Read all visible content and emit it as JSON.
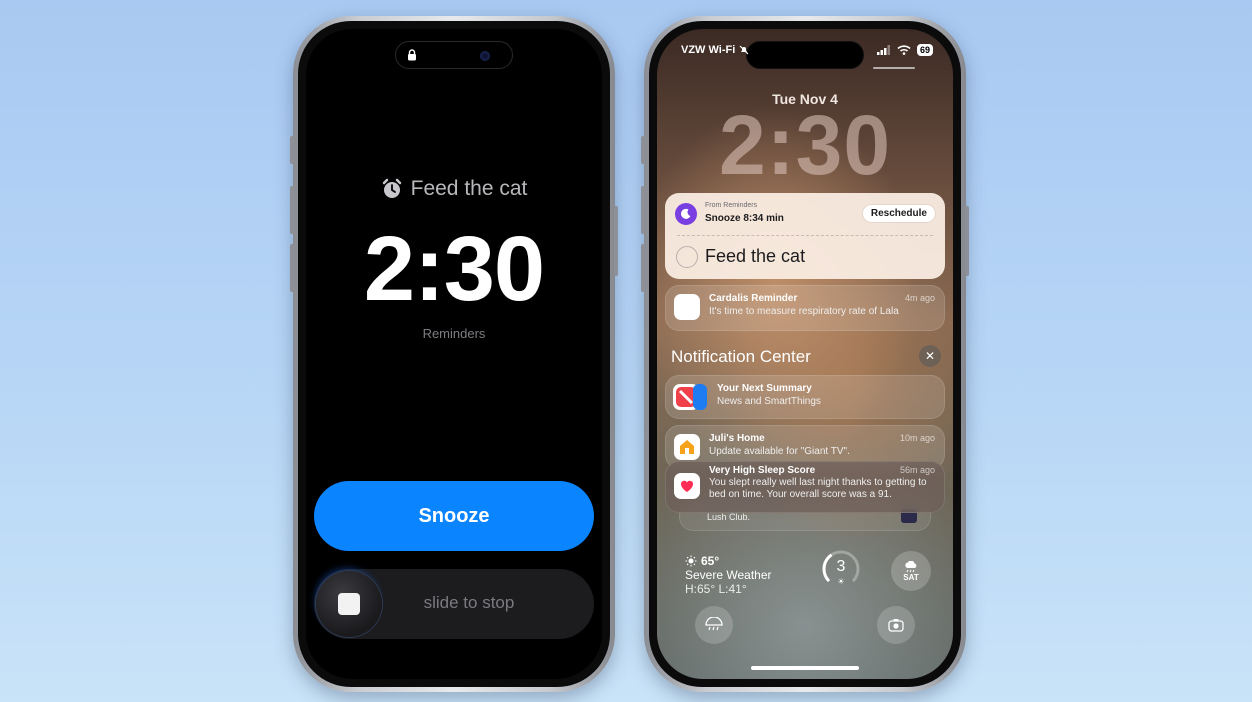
{
  "left_phone": {
    "alarm_title": "Feed the cat",
    "alarm_time": "2:30",
    "app_name": "Reminders",
    "snooze_label": "Snooze",
    "slide_label": "slide to stop"
  },
  "right_phone": {
    "status": {
      "carrier": "VZW Wi-Fi",
      "battery": "69"
    },
    "date": "Tue Nov 4",
    "time": "2:30",
    "reminder_card": {
      "from": "From Reminders",
      "snooze_text": "Snooze 8:34 min",
      "reschedule_label": "Reschedule",
      "task": "Feed the cat"
    },
    "notifications": [
      {
        "title": "Cardalis Reminder",
        "body": "It's time to measure respiratory rate of Lala",
        "ago": "4m ago"
      }
    ],
    "notification_center": {
      "title": "Notification Center",
      "items": [
        {
          "title": "Your Next Summary",
          "body": "News and SmartThings",
          "ago": ""
        },
        {
          "title": "Juli's Home",
          "body": "Update available for \"Giant TV\".",
          "ago": "10m ago"
        },
        {
          "title": "Very High Sleep Score",
          "body": "You slept really well last night thanks to getting to bed on time. Your overall score was a 91.",
          "ago": "56m ago"
        }
      ],
      "stacked_peek": "Lush Club."
    },
    "weather": {
      "temp": "65°",
      "condition": "Severe Weather",
      "high_low": "H:65° L:41°"
    },
    "uv_index": "3",
    "day_label": "SAT"
  },
  "colors": {
    "accent_blue": "#0a84ff",
    "background": "#b7d6f6",
    "reminders_purple": "#7a3fe0"
  }
}
